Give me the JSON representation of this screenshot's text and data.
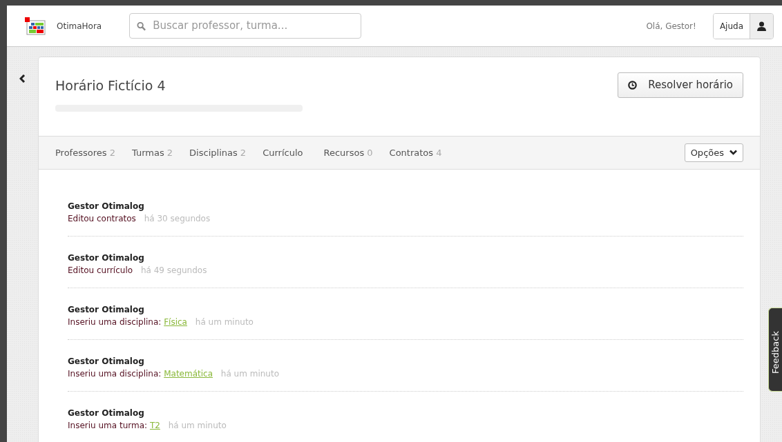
{
  "header": {
    "brand": "OtimaHora",
    "search": {
      "placeholder": "Buscar professor, turma..."
    },
    "greeting": "Olá, Gestor!",
    "help_button": "Ajuda"
  },
  "schedule": {
    "title": "Horário Fictício 4",
    "progress": {
      "level": 0
    },
    "solve_button": "Resolver horário"
  },
  "tabs": [
    {
      "label": "Professores",
      "count": "2"
    },
    {
      "label": "Turmas",
      "count": "2"
    },
    {
      "label": "Disciplinas",
      "count": "2"
    },
    {
      "label": "Currículo"
    },
    {
      "label": "Recursos",
      "count": "0"
    },
    {
      "label": "Contratos",
      "count": "4"
    }
  ],
  "options_button": "Opções",
  "activity": [
    {
      "user": "Gestor Otimalog",
      "action": "Editou contratos",
      "time": "há 30 segundos"
    },
    {
      "user": "Gestor Otimalog",
      "action": "Editou currículo",
      "time": "há 49 segundos"
    },
    {
      "user": "Gestor Otimalog",
      "action": "Inseriu uma disciplina:",
      "link": "Física",
      "time": "há um minuto"
    },
    {
      "user": "Gestor Otimalog",
      "action": "Inseriu uma disciplina:",
      "link": "Matemática",
      "time": "há um minuto"
    },
    {
      "user": "Gestor Otimalog",
      "action": "Inseriu uma turma:",
      "link": "T2",
      "time": "há um minuto"
    }
  ],
  "feedback_tab": "Feedback"
}
